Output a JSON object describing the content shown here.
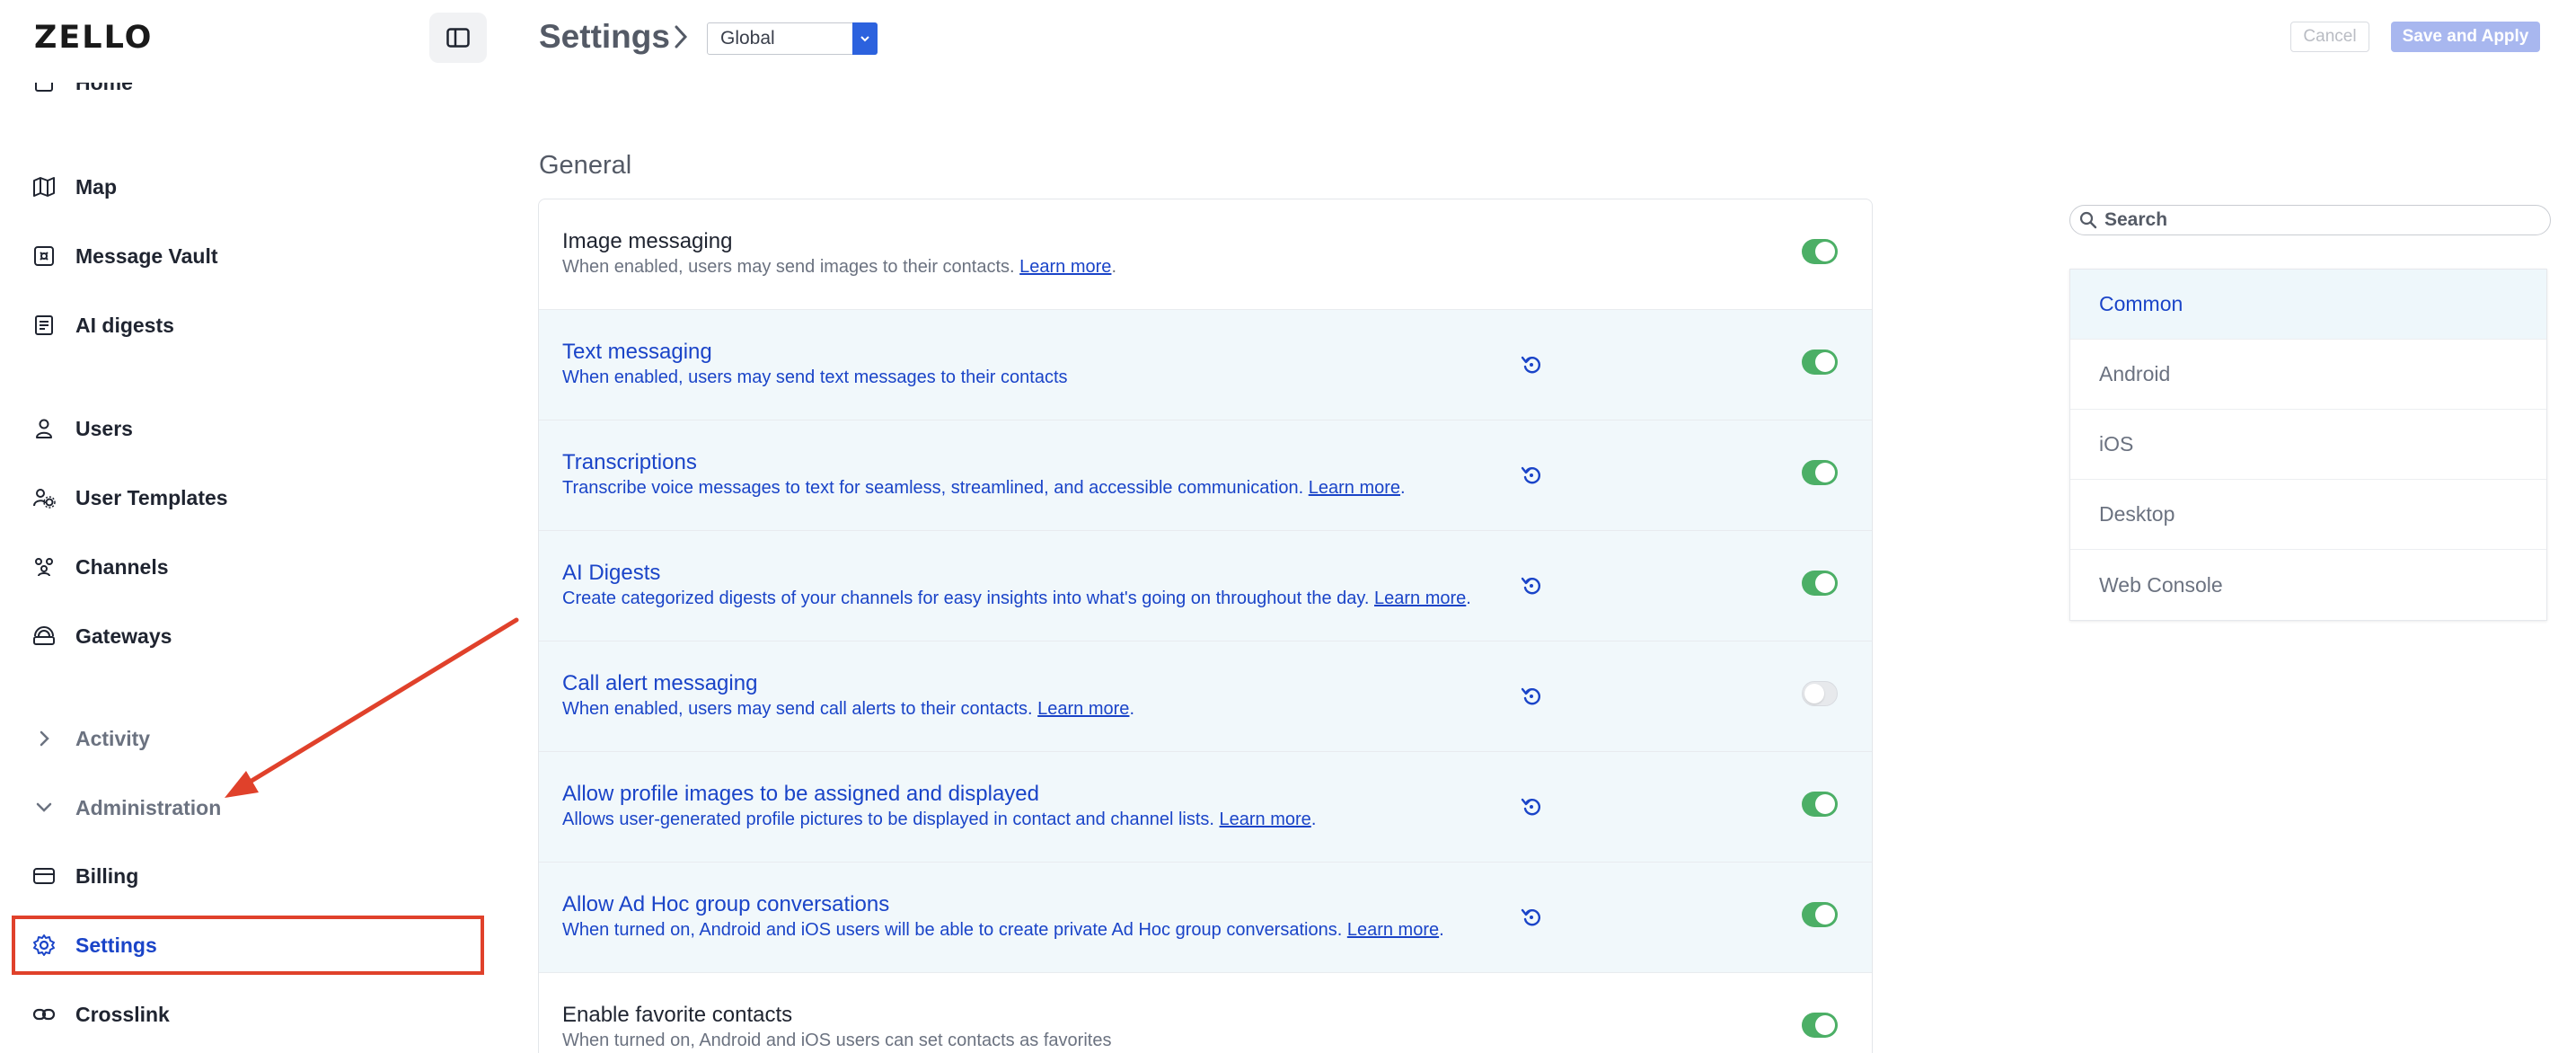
{
  "app": {
    "logo": "ZELLO"
  },
  "sidebar": {
    "items": [
      {
        "label": "Home",
        "icon": "home-icon"
      },
      {
        "label": "Map",
        "icon": "map-icon"
      },
      {
        "label": "Message Vault",
        "icon": "vault-icon"
      },
      {
        "label": "AI digests",
        "icon": "document-icon"
      },
      {
        "label": "Users",
        "icon": "user-icon"
      },
      {
        "label": "User Templates",
        "icon": "user-gear-icon"
      },
      {
        "label": "Channels",
        "icon": "group-icon"
      },
      {
        "label": "Gateways",
        "icon": "gateway-icon"
      },
      {
        "label": "Activity",
        "icon": "chevron-right-icon"
      },
      {
        "label": "Administration",
        "icon": "chevron-down-icon"
      },
      {
        "label": "Billing",
        "icon": "credit-card-icon"
      },
      {
        "label": "Settings",
        "icon": "gear-icon"
      },
      {
        "label": "Crosslink",
        "icon": "link-icon"
      }
    ],
    "active": "Settings"
  },
  "header": {
    "title": "Settings",
    "scope_value": "Global",
    "cancel_label": "Cancel",
    "save_label": "Save and Apply"
  },
  "section": {
    "title": "General",
    "rows": [
      {
        "title": "Image messaging",
        "desc": "When enabled, users may send images to their contacts. ",
        "link": "Learn more",
        "suffix": ".",
        "enabled": true,
        "modified": false
      },
      {
        "title": "Text messaging",
        "desc": "When enabled, users may send text messages to their contacts",
        "link": "",
        "suffix": "",
        "enabled": true,
        "modified": true
      },
      {
        "title": "Transcriptions",
        "desc": "Transcribe voice messages to text for seamless, streamlined, and accessible communication. ",
        "link": "Learn more",
        "suffix": ".",
        "enabled": true,
        "modified": true
      },
      {
        "title": "AI Digests",
        "desc": "Create categorized digests of your channels for easy insights into what's going on throughout the day. ",
        "link": "Learn more",
        "suffix": ".",
        "enabled": true,
        "modified": true
      },
      {
        "title": "Call alert messaging",
        "desc": "When enabled, users may send call alerts to their contacts. ",
        "link": "Learn more",
        "suffix": ".",
        "enabled": false,
        "modified": true
      },
      {
        "title": "Allow profile images to be assigned and displayed",
        "desc": "Allows user-generated profile pictures to be displayed in contact and channel lists. ",
        "link": "Learn more",
        "suffix": ".",
        "enabled": true,
        "modified": true
      },
      {
        "title": "Allow Ad Hoc group conversations",
        "desc": "When turned on, Android and iOS users will be able to create private Ad Hoc group conversations. ",
        "link": "Learn more",
        "suffix": ".",
        "enabled": true,
        "modified": true
      },
      {
        "title": "Enable favorite contacts",
        "desc": "When turned on, Android and iOS users can set contacts as favorites",
        "link": "",
        "suffix": "",
        "enabled": true,
        "modified": false
      }
    ]
  },
  "filter": {
    "search_placeholder": "Search",
    "platforms": [
      "Common",
      "Android",
      "iOS",
      "Desktop",
      "Web Console"
    ],
    "selected": "Common"
  },
  "colors": {
    "accent": "#1a44c8",
    "toggle_on": "#4caf66",
    "annotation": "#e0412b",
    "modified_row_bg": "#f1f8fb"
  }
}
